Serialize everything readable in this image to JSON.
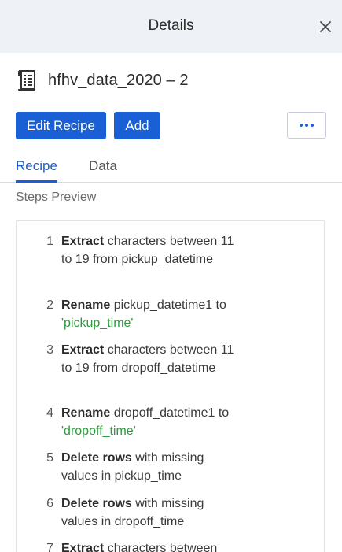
{
  "header": {
    "title": "Details"
  },
  "dataset": {
    "name": "hfhv_data_2020 – 2"
  },
  "toolbar": {
    "edit_label": "Edit Recipe",
    "add_label": "Add"
  },
  "tabs": [
    {
      "label": "Recipe",
      "active": true
    },
    {
      "label": "Data",
      "active": false
    }
  ],
  "section_label": "Steps Preview",
  "colors": {
    "accent": "#1a5fd6",
    "string": "#2e9a3e",
    "header_bg": "#eef2f6"
  },
  "steps": [
    {
      "num": "1",
      "kw": "Extract",
      "a": " characters between 11 to 19 from pickup_datetime",
      "str": "",
      "b": ""
    },
    {
      "num": "2",
      "kw": "Rename",
      "a": " pickup_datetime1 to ",
      "str": "'pickup_time'",
      "b": ""
    },
    {
      "num": "3",
      "kw": "Extract",
      "a": " characters between 11 to 19 from dropoff_datetime",
      "str": "",
      "b": ""
    },
    {
      "num": "4",
      "kw": "Rename",
      "a": " dropoff_datetime1 to ",
      "str": "'dropoff_time'",
      "b": ""
    },
    {
      "num": "5",
      "kw": "Delete rows",
      "a": " with missing values in pickup_time",
      "str": "",
      "b": ""
    },
    {
      "num": "6",
      "kw": "Delete rows",
      "a": " with missing values in dropoff_time",
      "str": "",
      "b": ""
    },
    {
      "num": "7",
      "kw": "Extract",
      "a": " characters between",
      "str": "",
      "b": ""
    }
  ]
}
